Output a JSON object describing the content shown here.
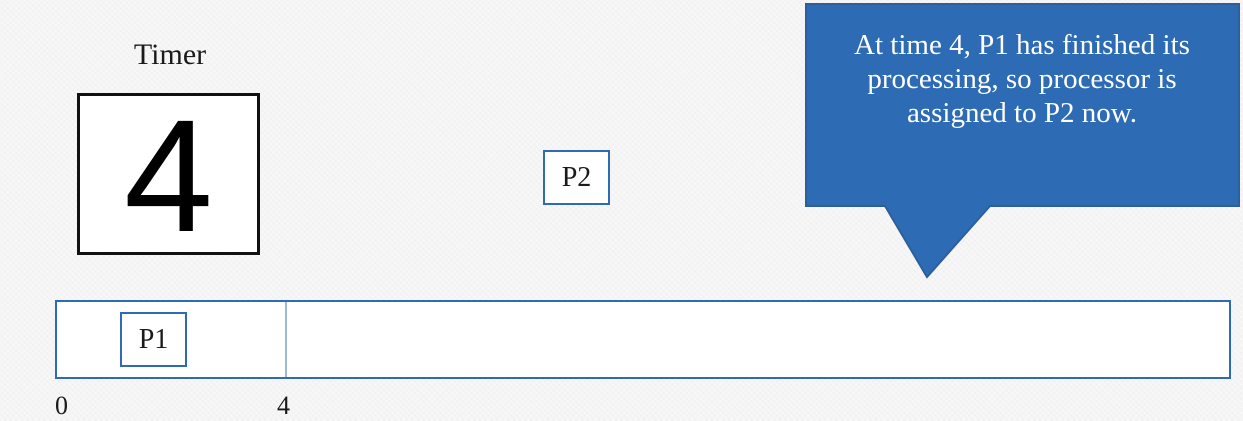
{
  "timer": {
    "label": "Timer",
    "value": "4"
  },
  "processes": {
    "waiting": "P2",
    "running": "P1"
  },
  "callout": {
    "text": "At time 4, P1 has finished its processing, so processor is assigned to P2 now."
  },
  "gantt": {
    "ticks": [
      "0",
      "4"
    ]
  },
  "colors": {
    "accent": "#2e6bb5",
    "callout_fill": "#2e6bb5",
    "callout_text": "#ffffff"
  }
}
